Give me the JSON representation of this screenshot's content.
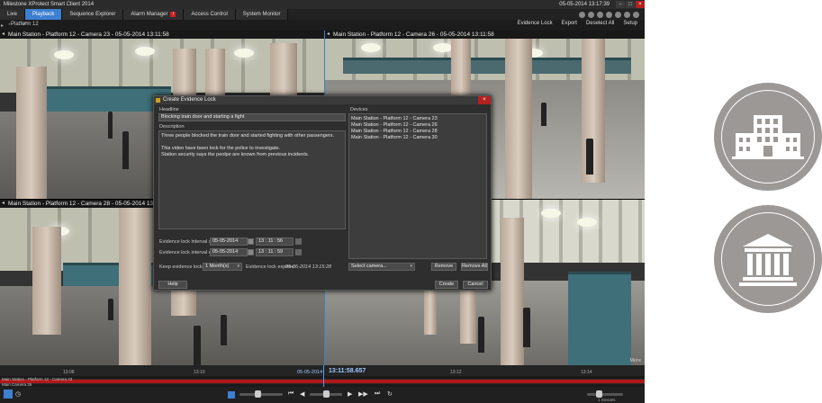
{
  "app": {
    "title": "Milestone XProtect Smart Client 2014",
    "datetime": "05-05-2014 13:17:39"
  },
  "tabs": [
    {
      "label": "Live"
    },
    {
      "label": "Playback"
    },
    {
      "label": "Sequence Explorer"
    },
    {
      "label": "Alarm Manager"
    },
    {
      "label": "Access Control"
    },
    {
      "label": "System Monitor"
    }
  ],
  "view": {
    "name": "Platform 12",
    "menus": [
      "Evidence Lock",
      "Export",
      "Deselect All",
      "Setup"
    ]
  },
  "cameras": [
    {
      "title": "Main Station - Platform 12 - Camera 23 - 05-05-2014 13:11:58"
    },
    {
      "title": "Main Station - Platform 12 - Camera 26 - 05-05-2014 13:11:58"
    },
    {
      "title": "Main Station - Platform 12 - Camera 28 - 05-05-2014 13:11:58"
    },
    {
      "title": ""
    }
  ],
  "dialog": {
    "title": "Create Evidence Lock",
    "headline_label": "Headline",
    "headline_value": "Blocking train door and starting a fight",
    "description_label": "Description",
    "description_value": "Three people blocked the train door and started fighting with other passengers.\n\nThis video have been lock for the police to investigate.\nStation security says the peolpe are known from previous incidents.",
    "devices_label": "Devices",
    "devices": [
      "Main Station - Platform 12 - Camera 23",
      "Main Station - Platform 12 - Camera 26",
      "Main Station - Platform 12 - Camera 28",
      "Main Station - Platform 12 - Camera 30"
    ],
    "start_label": "Evidence lock interval start:",
    "start_date": "05-05-2014",
    "start_time": "13 : 11 : 56",
    "end_label": "Evidence lock interval end:",
    "end_date": "05-05-2014",
    "end_time": "13 : 11 : 59",
    "keep_label": "Keep evidence lock for:",
    "keep_value": "1 Month(s)",
    "expires_label": "Evidence lock expires:",
    "expires_value": "05-06-2014 13:15:28",
    "select_camera": "Select camera...",
    "remove_label": "Remove",
    "remove_all_label": "Remove All",
    "help_label": "Help",
    "create_label": "Create",
    "cancel_label": "Cancel"
  },
  "timeline": {
    "current_time": "13:11:58.657",
    "date": "05-05-2014",
    "camera_label": "Main Station - Platform 12 - Camera 23",
    "camera_label2": "Main Camera 26",
    "ticks": [
      "13:08",
      "13:10",
      "13:12",
      "13:14"
    ],
    "more_label": "More",
    "speed_label": "1 minutes"
  },
  "colors": {
    "accent": "#3d7fd0",
    "alert": "#b01818",
    "badge_gray": "#9b9896"
  },
  "badges": [
    {
      "icon": "office-building-icon"
    },
    {
      "icon": "government-building-icon"
    }
  ]
}
